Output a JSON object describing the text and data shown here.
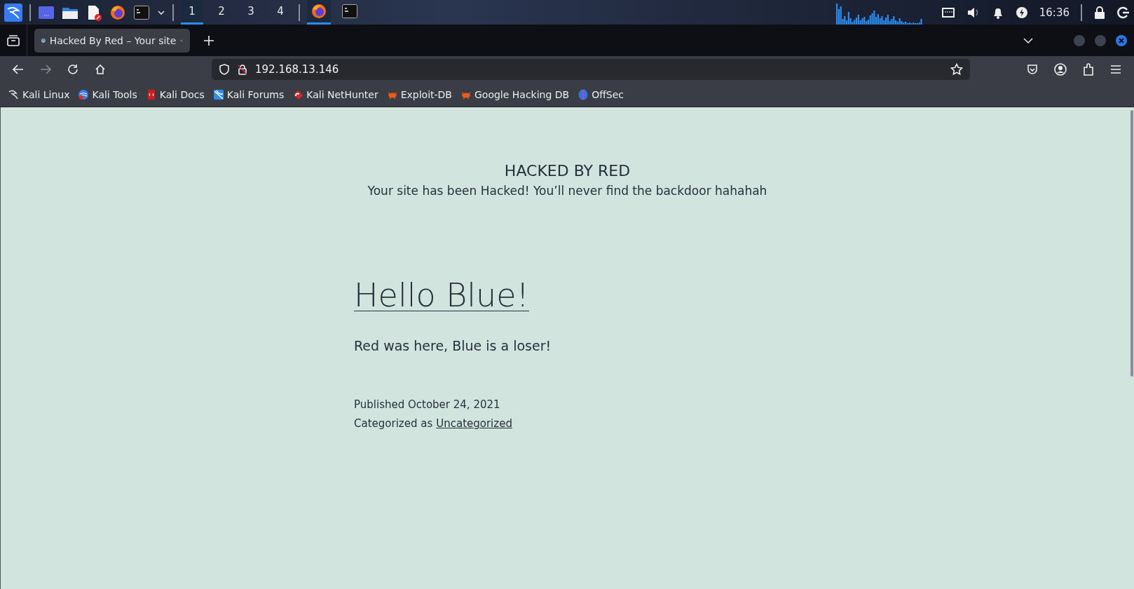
{
  "taskbar": {
    "workspaces": [
      {
        "label": "1",
        "selected": true
      },
      {
        "label": "2",
        "selected": false
      },
      {
        "label": "3",
        "selected": false
      },
      {
        "label": "4",
        "selected": false
      }
    ],
    "apps": [
      {
        "kind": "firefox",
        "selected": true
      },
      {
        "kind": "terminal",
        "selected": false
      }
    ],
    "clock": "16:36"
  },
  "tabs": [
    {
      "title": "Hacked By Red – Your site",
      "selected": true
    }
  ],
  "address_bar": {
    "url": "192.168.13.146"
  },
  "bookmarks": [
    {
      "kind": "dragon",
      "label": "Kali Linux"
    },
    {
      "kind": "tools",
      "label": "Kali Tools"
    },
    {
      "kind": "docs",
      "label": "Kali Docs"
    },
    {
      "kind": "forums",
      "label": "Kali Forums"
    },
    {
      "kind": "nethunter",
      "label": "Kali NetHunter"
    },
    {
      "kind": "bug",
      "label": "Exploit-DB"
    },
    {
      "kind": "bug",
      "label": "Google Hacking DB"
    },
    {
      "kind": "offsec",
      "label": "OffSec"
    }
  ],
  "page": {
    "site_title": "HACKED BY RED",
    "tagline": "Your site has been Hacked! You’ll never find the backdoor hahahah",
    "post_title": "Hello Blue!",
    "post_body": "Red was here, Blue is a loser!",
    "published": "Published October 24, 2021",
    "category_prefix": "Categorized as",
    "category": "Uncategorized"
  }
}
